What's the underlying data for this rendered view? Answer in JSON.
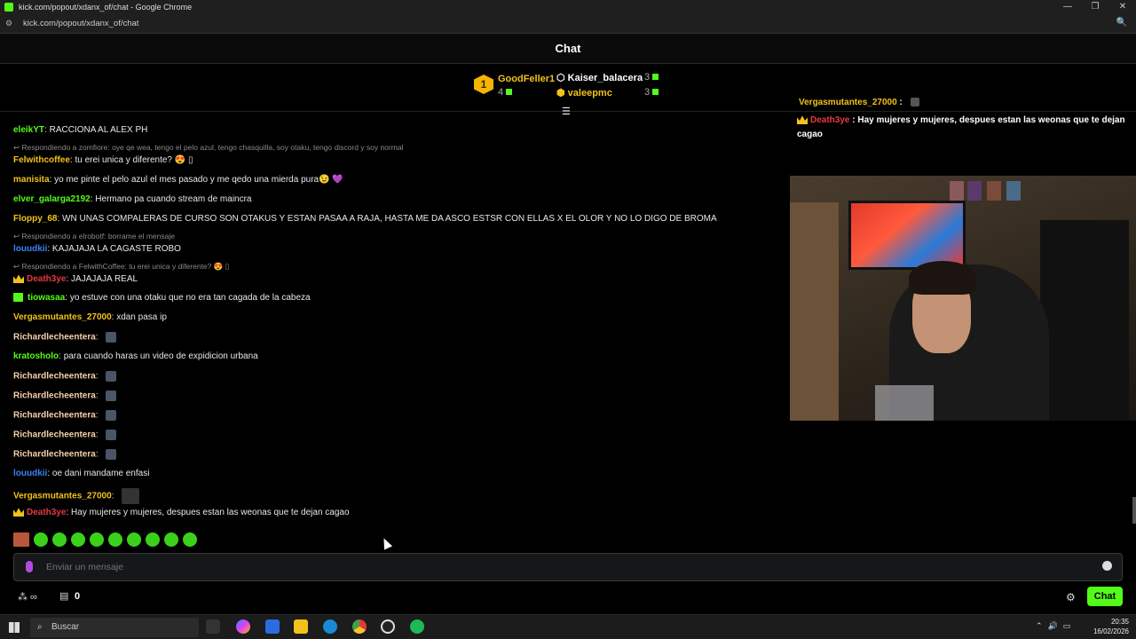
{
  "window": {
    "title": "kick.com/popout/xdanx_of/chat - Google Chrome",
    "url": "kick.com/popout/xdanx_of/chat"
  },
  "chat": {
    "header": "Chat",
    "input_placeholder": "Enviar un mensaje",
    "send_label": "Chat",
    "viewers_count": "0"
  },
  "leaderboard": [
    {
      "name": "GoodFeller1",
      "count": "4",
      "rank": "1"
    },
    {
      "name": "Kaiser_balacera",
      "count": "3"
    },
    {
      "name": "valeepmc",
      "count": "3"
    }
  ],
  "messages": [
    {
      "user": "eleikYT",
      "color": "#53fc18",
      "text": "RACCIONA AL ALEX PH"
    },
    {
      "reply": "Respondiendo a zomfiore: oye qe wea, tengo el pelo azul, tengo chasquilla, soy otaku, tengo discord y soy normal"
    },
    {
      "user": "Felwithcoffee",
      "color": "#f2c21b",
      "text": "tu erei unica y diferente? 😍 ▯"
    },
    {
      "user": "manisita",
      "color": "#f2c21b",
      "text": "yo me pinte el pelo azul el mes pasado y me qedo una mierda pura😉 💜"
    },
    {
      "user": "elver_galarga2192",
      "color": "#53fc18",
      "text": "Hermano pa cuando stream de maincra"
    },
    {
      "user": "Floppy_68",
      "color": "#f2c21b",
      "text": "WN UNAS COMPALERAS DE CURSO SON OTAKUS Y ESTAN PASAA A RAJA, HASTA ME DA ASCO ESTSR CON ELLAS X EL OLOR Y NO LO DIGO DE BROMA"
    },
    {
      "reply": "Respondiendo a elrobotf: borrame el mensaje"
    },
    {
      "user": "louudkii",
      "color": "#3b82f6",
      "text": "KAJAJAJA LA CAGASTE ROBO"
    },
    {
      "reply": "Respondiendo a FelwithCoffee: tu erei unica y diferente? 😍 ▯"
    },
    {
      "user": "Death3ye",
      "color": "#e63946",
      "text": "JAJAJAJA REAL",
      "badge": "crown"
    },
    {
      "user": "tiowasaa",
      "color": "#53fc18",
      "text": "yo estuve con una otaku que no era tan cagada de la cabeza",
      "badge": "gift"
    },
    {
      "user": "Vergasmutantes_27000",
      "color": "#f2c21b",
      "text": "xdan pasa ip"
    },
    {
      "user": "Richardlecheentera",
      "color": "#f5d0a9",
      "text": "",
      "emote": true
    },
    {
      "user": "kratosholo",
      "color": "#53fc18",
      "text": "para cuando haras un video de expidicion urbana"
    },
    {
      "user": "Richardlecheentera",
      "color": "#f5d0a9",
      "text": "",
      "emote": true
    },
    {
      "user": "Richardlecheentera",
      "color": "#f5d0a9",
      "text": "",
      "emote": true
    },
    {
      "user": "Richardlecheentera",
      "color": "#f5d0a9",
      "text": "",
      "emote": true
    },
    {
      "user": "Richardlecheentera",
      "color": "#f5d0a9",
      "text": "",
      "emote": true
    },
    {
      "user": "Richardlecheentera",
      "color": "#f5d0a9",
      "text": "",
      "emote": true
    },
    {
      "user": "louudkii",
      "color": "#3b82f6",
      "text": "oe dani mandame enfasi"
    },
    {
      "user": "Vergasmutantes_27000",
      "color": "#f2c21b",
      "text": "",
      "emote": true
    },
    {
      "user": "Death3ye",
      "color": "#e63946",
      "text": "Hay mujeres y mujeres, despues estan las weonas que te dejan cagao",
      "badge": "crown"
    }
  ],
  "overlay": {
    "line1_user": "Vergasmutantes_27000",
    "line2_user": "Death3ye",
    "line2_text": "Hay mujeres y mujeres, despues estan las weonas que te dejan cagao"
  },
  "taskbar": {
    "search_label": "Buscar",
    "time": "20:35",
    "date": "16/02/2026"
  }
}
